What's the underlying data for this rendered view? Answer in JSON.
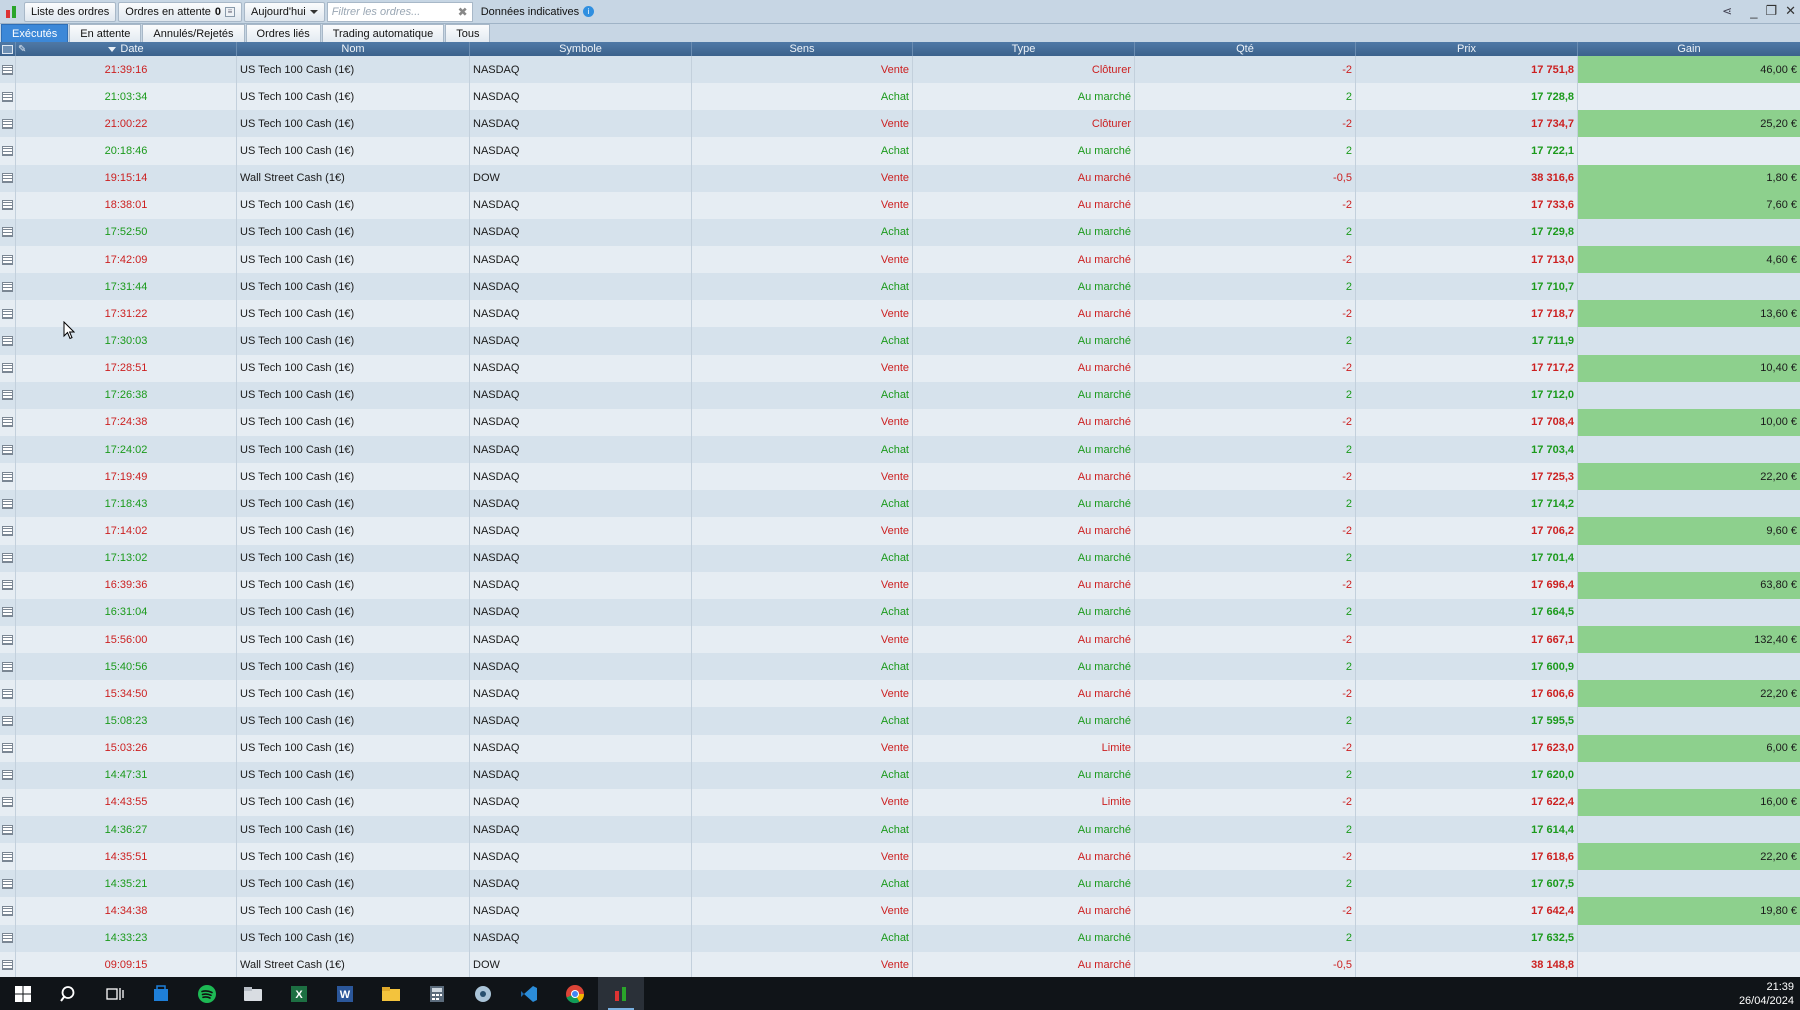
{
  "toolbar": {
    "orders_list_label": "Liste des ordres",
    "pending_label": "Ordres en attente",
    "pending_count": "0",
    "period_label": "Aujourd'hui",
    "filter_placeholder": "Filtrer les ordres...",
    "indicative_label": "Données indicatives",
    "info_glyph": "i"
  },
  "tabs": [
    "Exécutés",
    "En attente",
    "Annulés/Rejetés",
    "Ordres liés",
    "Trading automatique",
    "Tous"
  ],
  "columns": {
    "date": "Date",
    "nom": "Nom",
    "symbole": "Symbole",
    "sens": "Sens",
    "type": "Type",
    "qte": "Qté",
    "prix": "Prix",
    "gain": "Gain"
  },
  "colors": {
    "sell": "#cc1f1f",
    "buy": "#1b9a1b",
    "gain_bg": "#8dd08d",
    "active_tab": "#3c88d8"
  },
  "rows": [
    {
      "date": "21:39:16",
      "nom": "US Tech 100 Cash (1€)",
      "symbole": "NASDAQ",
      "sens": "Vente",
      "type": "Clôturer",
      "qte": "-2",
      "prix": "17 751,8",
      "gain": "46,00 €"
    },
    {
      "date": "21:03:34",
      "nom": "US Tech 100 Cash (1€)",
      "symbole": "NASDAQ",
      "sens": "Achat",
      "type": "Au marché",
      "qte": "2",
      "prix": "17 728,8",
      "gain": ""
    },
    {
      "date": "21:00:22",
      "nom": "US Tech 100 Cash (1€)",
      "symbole": "NASDAQ",
      "sens": "Vente",
      "type": "Clôturer",
      "qte": "-2",
      "prix": "17 734,7",
      "gain": "25,20 €"
    },
    {
      "date": "20:18:46",
      "nom": "US Tech 100 Cash (1€)",
      "symbole": "NASDAQ",
      "sens": "Achat",
      "type": "Au marché",
      "qte": "2",
      "prix": "17 722,1",
      "gain": ""
    },
    {
      "date": "19:15:14",
      "nom": "Wall Street Cash (1€)",
      "symbole": "DOW",
      "sens": "Vente",
      "type": "Au marché",
      "qte": "-0,5",
      "prix": "38 316,6",
      "gain": "1,80 €"
    },
    {
      "date": "18:38:01",
      "nom": "US Tech 100 Cash (1€)",
      "symbole": "NASDAQ",
      "sens": "Vente",
      "type": "Au marché",
      "qte": "-2",
      "prix": "17 733,6",
      "gain": "7,60 €"
    },
    {
      "date": "17:52:50",
      "nom": "US Tech 100 Cash (1€)",
      "symbole": "NASDAQ",
      "sens": "Achat",
      "type": "Au marché",
      "qte": "2",
      "prix": "17 729,8",
      "gain": ""
    },
    {
      "date": "17:42:09",
      "nom": "US Tech 100 Cash (1€)",
      "symbole": "NASDAQ",
      "sens": "Vente",
      "type": "Au marché",
      "qte": "-2",
      "prix": "17 713,0",
      "gain": "4,60 €"
    },
    {
      "date": "17:31:44",
      "nom": "US Tech 100 Cash (1€)",
      "symbole": "NASDAQ",
      "sens": "Achat",
      "type": "Au marché",
      "qte": "2",
      "prix": "17 710,7",
      "gain": ""
    },
    {
      "date": "17:31:22",
      "nom": "US Tech 100 Cash (1€)",
      "symbole": "NASDAQ",
      "sens": "Vente",
      "type": "Au marché",
      "qte": "-2",
      "prix": "17 718,7",
      "gain": "13,60 €"
    },
    {
      "date": "17:30:03",
      "nom": "US Tech 100 Cash (1€)",
      "symbole": "NASDAQ",
      "sens": "Achat",
      "type": "Au marché",
      "qte": "2",
      "prix": "17 711,9",
      "gain": ""
    },
    {
      "date": "17:28:51",
      "nom": "US Tech 100 Cash (1€)",
      "symbole": "NASDAQ",
      "sens": "Vente",
      "type": "Au marché",
      "qte": "-2",
      "prix": "17 717,2",
      "gain": "10,40 €"
    },
    {
      "date": "17:26:38",
      "nom": "US Tech 100 Cash (1€)",
      "symbole": "NASDAQ",
      "sens": "Achat",
      "type": "Au marché",
      "qte": "2",
      "prix": "17 712,0",
      "gain": ""
    },
    {
      "date": "17:24:38",
      "nom": "US Tech 100 Cash (1€)",
      "symbole": "NASDAQ",
      "sens": "Vente",
      "type": "Au marché",
      "qte": "-2",
      "prix": "17 708,4",
      "gain": "10,00 €"
    },
    {
      "date": "17:24:02",
      "nom": "US Tech 100 Cash (1€)",
      "symbole": "NASDAQ",
      "sens": "Achat",
      "type": "Au marché",
      "qte": "2",
      "prix": "17 703,4",
      "gain": ""
    },
    {
      "date": "17:19:49",
      "nom": "US Tech 100 Cash (1€)",
      "symbole": "NASDAQ",
      "sens": "Vente",
      "type": "Au marché",
      "qte": "-2",
      "prix": "17 725,3",
      "gain": "22,20 €"
    },
    {
      "date": "17:18:43",
      "nom": "US Tech 100 Cash (1€)",
      "symbole": "NASDAQ",
      "sens": "Achat",
      "type": "Au marché",
      "qte": "2",
      "prix": "17 714,2",
      "gain": ""
    },
    {
      "date": "17:14:02",
      "nom": "US Tech 100 Cash (1€)",
      "symbole": "NASDAQ",
      "sens": "Vente",
      "type": "Au marché",
      "qte": "-2",
      "prix": "17 706,2",
      "gain": "9,60 €"
    },
    {
      "date": "17:13:02",
      "nom": "US Tech 100 Cash (1€)",
      "symbole": "NASDAQ",
      "sens": "Achat",
      "type": "Au marché",
      "qte": "2",
      "prix": "17 701,4",
      "gain": ""
    },
    {
      "date": "16:39:36",
      "nom": "US Tech 100 Cash (1€)",
      "symbole": "NASDAQ",
      "sens": "Vente",
      "type": "Au marché",
      "qte": "-2",
      "prix": "17 696,4",
      "gain": "63,80 €"
    },
    {
      "date": "16:31:04",
      "nom": "US Tech 100 Cash (1€)",
      "symbole": "NASDAQ",
      "sens": "Achat",
      "type": "Au marché",
      "qte": "2",
      "prix": "17 664,5",
      "gain": ""
    },
    {
      "date": "15:56:00",
      "nom": "US Tech 100 Cash (1€)",
      "symbole": "NASDAQ",
      "sens": "Vente",
      "type": "Au marché",
      "qte": "-2",
      "prix": "17 667,1",
      "gain": "132,40 €"
    },
    {
      "date": "15:40:56",
      "nom": "US Tech 100 Cash (1€)",
      "symbole": "NASDAQ",
      "sens": "Achat",
      "type": "Au marché",
      "qte": "2",
      "prix": "17 600,9",
      "gain": ""
    },
    {
      "date": "15:34:50",
      "nom": "US Tech 100 Cash (1€)",
      "symbole": "NASDAQ",
      "sens": "Vente",
      "type": "Au marché",
      "qte": "-2",
      "prix": "17 606,6",
      "gain": "22,20 €"
    },
    {
      "date": "15:08:23",
      "nom": "US Tech 100 Cash (1€)",
      "symbole": "NASDAQ",
      "sens": "Achat",
      "type": "Au marché",
      "qte": "2",
      "prix": "17 595,5",
      "gain": ""
    },
    {
      "date": "15:03:26",
      "nom": "US Tech 100 Cash (1€)",
      "symbole": "NASDAQ",
      "sens": "Vente",
      "type": "Limite",
      "qte": "-2",
      "prix": "17 623,0",
      "gain": "6,00 €"
    },
    {
      "date": "14:47:31",
      "nom": "US Tech 100 Cash (1€)",
      "symbole": "NASDAQ",
      "sens": "Achat",
      "type": "Au marché",
      "qte": "2",
      "prix": "17 620,0",
      "gain": ""
    },
    {
      "date": "14:43:55",
      "nom": "US Tech 100 Cash (1€)",
      "symbole": "NASDAQ",
      "sens": "Vente",
      "type": "Limite",
      "qte": "-2",
      "prix": "17 622,4",
      "gain": "16,00 €"
    },
    {
      "date": "14:36:27",
      "nom": "US Tech 100 Cash (1€)",
      "symbole": "NASDAQ",
      "sens": "Achat",
      "type": "Au marché",
      "qte": "2",
      "prix": "17 614,4",
      "gain": ""
    },
    {
      "date": "14:35:51",
      "nom": "US Tech 100 Cash (1€)",
      "symbole": "NASDAQ",
      "sens": "Vente",
      "type": "Au marché",
      "qte": "-2",
      "prix": "17 618,6",
      "gain": "22,20 €"
    },
    {
      "date": "14:35:21",
      "nom": "US Tech 100 Cash (1€)",
      "symbole": "NASDAQ",
      "sens": "Achat",
      "type": "Au marché",
      "qte": "2",
      "prix": "17 607,5",
      "gain": ""
    },
    {
      "date": "14:34:38",
      "nom": "US Tech 100 Cash (1€)",
      "symbole": "NASDAQ",
      "sens": "Vente",
      "type": "Au marché",
      "qte": "-2",
      "prix": "17 642,4",
      "gain": "19,80 €"
    },
    {
      "date": "14:33:23",
      "nom": "US Tech 100 Cash (1€)",
      "symbole": "NASDAQ",
      "sens": "Achat",
      "type": "Au marché",
      "qte": "2",
      "prix": "17 632,5",
      "gain": ""
    },
    {
      "date": "09:09:15",
      "nom": "Wall Street Cash (1€)",
      "symbole": "DOW",
      "sens": "Vente",
      "type": "Au marché",
      "qte": "-0,5",
      "prix": "38 148,8",
      "gain": ""
    }
  ],
  "taskbar": {
    "apps": [
      "windows-start-icon",
      "search-icon",
      "task-view-icon",
      "store-icon",
      "spotify-icon",
      "folder-icon",
      "excel-icon",
      "word-icon",
      "file-explorer-icon",
      "calculator-icon",
      "settings-icon",
      "vscode-icon",
      "chrome-icon",
      "trading-app-icon"
    ],
    "time": "21:39",
    "date": "26/04/2024"
  }
}
